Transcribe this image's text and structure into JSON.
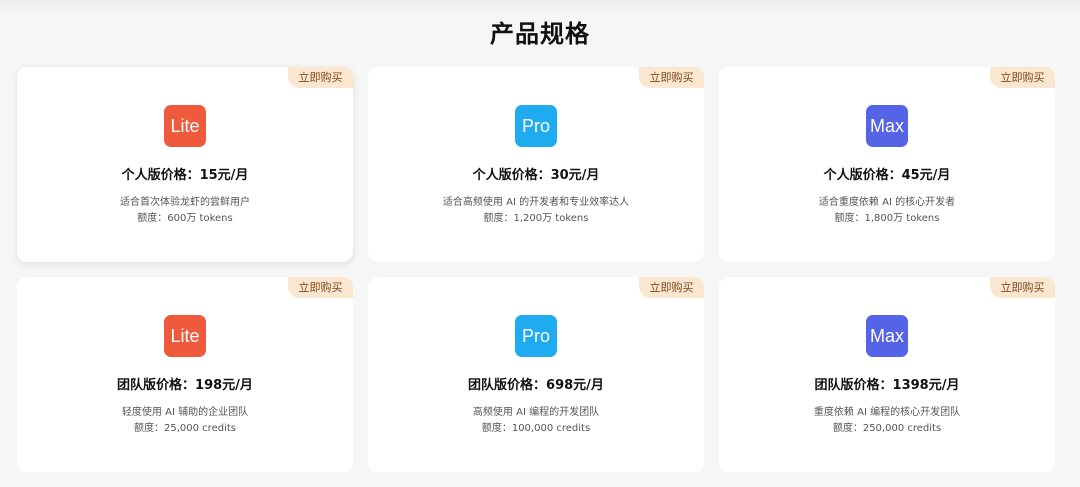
{
  "page": {
    "title": "产品规格"
  },
  "colors": {
    "lite": "#ee5a3b",
    "pro": "#1eabf0",
    "max": "#5564e6",
    "tag_bg": "#fbe6cf"
  },
  "cards": [
    {
      "logo": "Lite",
      "logo_icon": "lite-logo-icon",
      "buy_label": "立即购买",
      "price": "个人版价格：15元/月",
      "description": "适合首次体验龙虾的尝鲜用户",
      "quota": "额度：600万 tokens"
    },
    {
      "logo": "Pro",
      "logo_icon": "pro-logo-icon",
      "buy_label": "立即购买",
      "price": "个人版价格：30元/月",
      "description": "适合高频使用 AI 的开发者和专业效率达人",
      "quota": "额度：1,200万 tokens"
    },
    {
      "logo": "Max",
      "logo_icon": "max-logo-icon",
      "buy_label": "立即购买",
      "price": "个人版价格：45元/月",
      "description": "适合重度依赖 AI 的核心开发者",
      "quota": "额度：1,800万 tokens"
    },
    {
      "logo": "Lite",
      "logo_icon": "lite-logo-icon",
      "buy_label": "立即购买",
      "price": "团队版价格：198元/月",
      "description": "轻度使用 AI 辅助的企业团队",
      "quota": "额度：25,000 credits"
    },
    {
      "logo": "Pro",
      "logo_icon": "pro-logo-icon",
      "buy_label": "立即购买",
      "price": "团队版价格：698元/月",
      "description": "高频使用 AI 编程的开发团队",
      "quota": "额度：100,000 credits"
    },
    {
      "logo": "Max",
      "logo_icon": "max-logo-icon",
      "buy_label": "立即购买",
      "price": "团队版价格：1398元/月",
      "description": "重度依赖 AI 编程的核心开发团队",
      "quota": "额度：250,000 credits"
    }
  ]
}
